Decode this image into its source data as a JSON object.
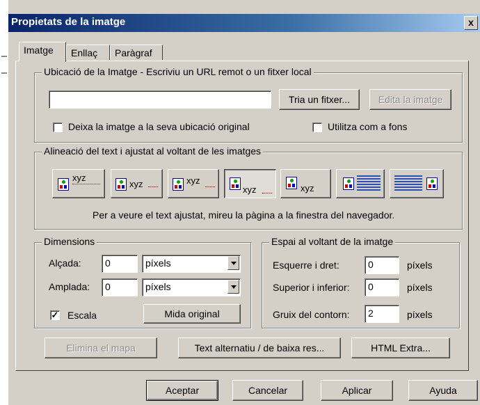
{
  "window": {
    "title": "Propietats de la imatge",
    "close_glyph": "x"
  },
  "tabs": [
    "Imatge",
    "Enllaç",
    "Paràgraf"
  ],
  "location": {
    "legend": "Ubicació de la Imatge - Escriviu un URL remot o un fitxer local",
    "url_value": "",
    "choose_file": "Tria un fitxer...",
    "edit_image": "Edita la imatge",
    "keep_original": {
      "label": "Deixa la imatge a la seva ubicació original",
      "checked": false
    },
    "use_background": {
      "label": "Utilitza com a fons",
      "checked": false
    }
  },
  "alignment": {
    "legend": "Alineació del text i ajustat al voltant de les imatges",
    "options": [
      {
        "name": "align-top-button",
        "text": "xyz",
        "pressed": false
      },
      {
        "name": "align-middle-button",
        "text": "xyz",
        "pressed": false
      },
      {
        "name": "align-center-button",
        "text": "xyz",
        "pressed": false
      },
      {
        "name": "align-bottom-button",
        "text": "xyz",
        "pressed": true
      },
      {
        "name": "align-baseline-button",
        "text": "xyz",
        "pressed": false
      },
      {
        "name": "wrap-left-button",
        "text": "",
        "pressed": false
      },
      {
        "name": "wrap-right-button",
        "text": "",
        "pressed": false
      }
    ],
    "hint": "Per a veure el text ajustat, mireu la pàgina a la finestra del navegador."
  },
  "dimensions": {
    "legend": "Dimensions",
    "height_label": "Alçada:",
    "height_value": "0",
    "height_unit": "píxels",
    "width_label": "Amplada:",
    "width_value": "0",
    "width_unit": "píxels",
    "scale_label": "Escala",
    "scale_checked": true,
    "original_size": "Mida original"
  },
  "spacing": {
    "legend": "Espai al voltant de la imatge",
    "left_right_label": "Esquerre i dret:",
    "left_right_value": "0",
    "top_bottom_label": "Superior i inferior:",
    "top_bottom_value": "0",
    "border_label": "Gruix del contorn:",
    "border_value": "2",
    "unit": "píxels"
  },
  "extra_buttons": {
    "remove_map": "Elimina el mapa",
    "alt_text": "Text alternatiu / de baixa res...",
    "html_extra": "HTML Extra..."
  },
  "footer": {
    "ok": "Aceptar",
    "cancel": "Cancelar",
    "apply": "Aplicar",
    "help": "Ayuda"
  },
  "colors": {
    "titlebar_start": "#0a246a",
    "titlebar_end": "#a6caf0",
    "face": "#d4d0c8"
  }
}
